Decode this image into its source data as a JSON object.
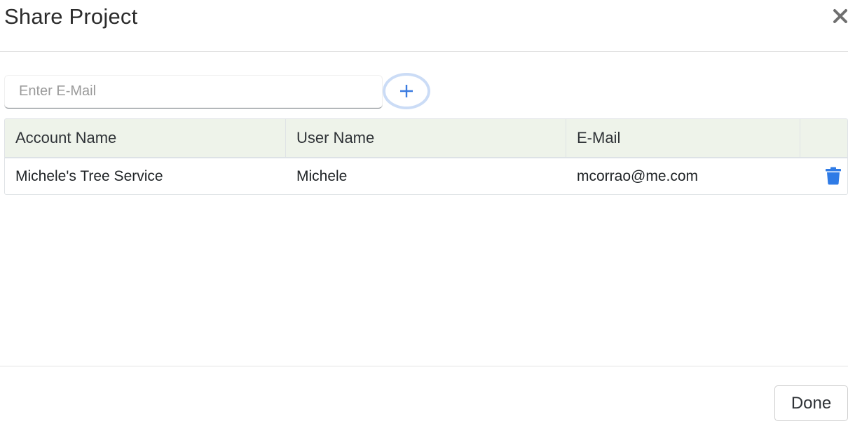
{
  "dialog": {
    "title": "Share Project",
    "close_icon": "close-icon"
  },
  "invite": {
    "email_placeholder": "Enter E-Mail",
    "email_value": "",
    "add_icon": "plus-icon"
  },
  "table": {
    "columns": [
      "Account Name",
      "User Name",
      "E-Mail",
      ""
    ],
    "rows": [
      {
        "account_name": "Michele's Tree Service",
        "user_name": "Michele",
        "email": "mcorrao@me.com",
        "delete_icon": "trash-icon"
      }
    ]
  },
  "footer": {
    "done_label": "Done"
  },
  "colors": {
    "accent": "#3a7be0",
    "header_bg": "#eef3ea",
    "add_ring": "#cbdcf6"
  }
}
